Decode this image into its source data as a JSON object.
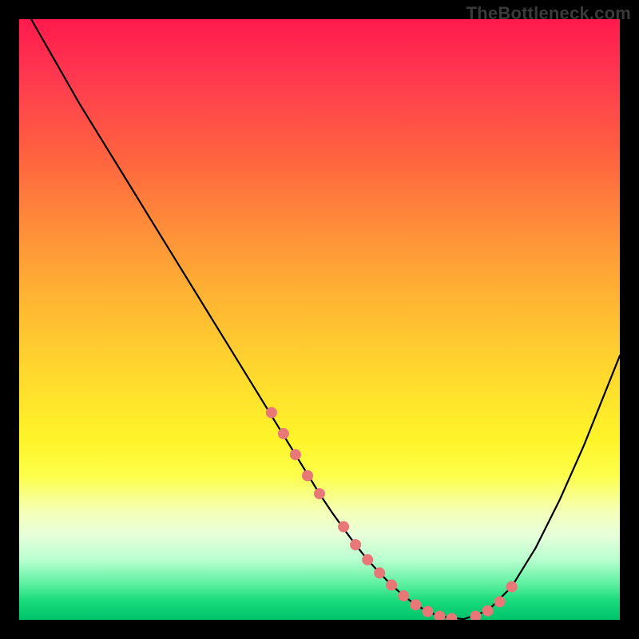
{
  "watermark": "TheBottleneck.com",
  "colors": {
    "dot": "#e87777",
    "curve": "#000000",
    "gradient_top": "#ff1a4d",
    "gradient_bottom": "#00c46a"
  },
  "chart_data": {
    "type": "line",
    "title": "",
    "xlabel": "",
    "ylabel": "",
    "xlim": [
      0,
      100
    ],
    "ylim": [
      0,
      100
    ],
    "series": [
      {
        "name": "bottleneck-curve",
        "x": [
          2,
          6,
          10,
          14,
          18,
          22,
          26,
          30,
          34,
          38,
          42,
          46,
          50,
          52,
          54,
          56,
          58,
          60,
          62,
          64,
          66,
          68,
          70,
          74,
          78,
          82,
          86,
          90,
          94,
          98,
          100
        ],
        "y": [
          100,
          93,
          86,
          79.5,
          73,
          66.5,
          60,
          53.5,
          47,
          40.5,
          34,
          27.5,
          21,
          18,
          15.2,
          12.5,
          10,
          7.8,
          5.8,
          4,
          2.5,
          1.4,
          0.6,
          0.1,
          1.5,
          5.5,
          12,
          20,
          29,
          39,
          44
        ]
      }
    ],
    "markers": {
      "name": "highlighted-points",
      "x": [
        42,
        44,
        46,
        48,
        50,
        54,
        56,
        58,
        60,
        62,
        64,
        66,
        68,
        70,
        72,
        76,
        78,
        80,
        82
      ],
      "y": [
        34.5,
        31,
        27.5,
        24,
        21,
        15.5,
        12.5,
        10,
        7.8,
        5.8,
        4,
        2.5,
        1.4,
        0.6,
        0.2,
        0.6,
        1.5,
        3,
        5.5
      ]
    }
  }
}
